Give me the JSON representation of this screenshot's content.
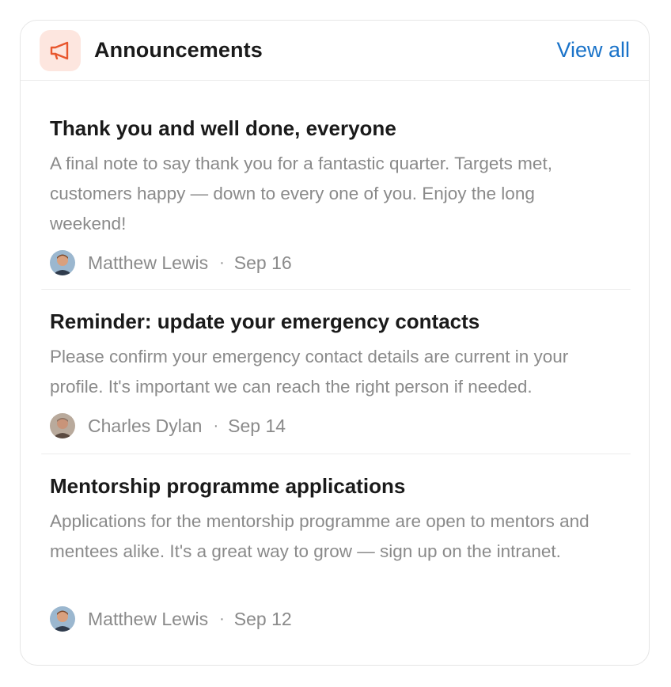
{
  "header": {
    "title": "Announcements",
    "view_all_label": "View all",
    "icon": "megaphone-icon",
    "accent_color": "#e8572e",
    "icon_bg_color": "#fde6df",
    "link_color": "#1a73c9"
  },
  "announcements": [
    {
      "title": "Thank you and well done, everyone",
      "body": "A final note to say thank you for a fantastic quarter. Targets met, customers happy — down to every one of you. Enjoy the long weekend!",
      "author": "Matthew Lewis",
      "separator": "·",
      "date": "Sep 16"
    },
    {
      "title": "Reminder: update your emergency contacts",
      "body": "Please confirm your emergency contact details are current in your profile. It's important we can reach the right person if needed.",
      "author": "Charles Dylan",
      "separator": "·",
      "date": "Sep 14"
    },
    {
      "title": "Mentorship programme applications",
      "body": "Applications for the mentorship programme are open to mentors and mentees alike. It's a great way to grow — sign up on the intranet.",
      "author": "Matthew Lewis",
      "separator": "·",
      "date": "Sep 12"
    }
  ]
}
